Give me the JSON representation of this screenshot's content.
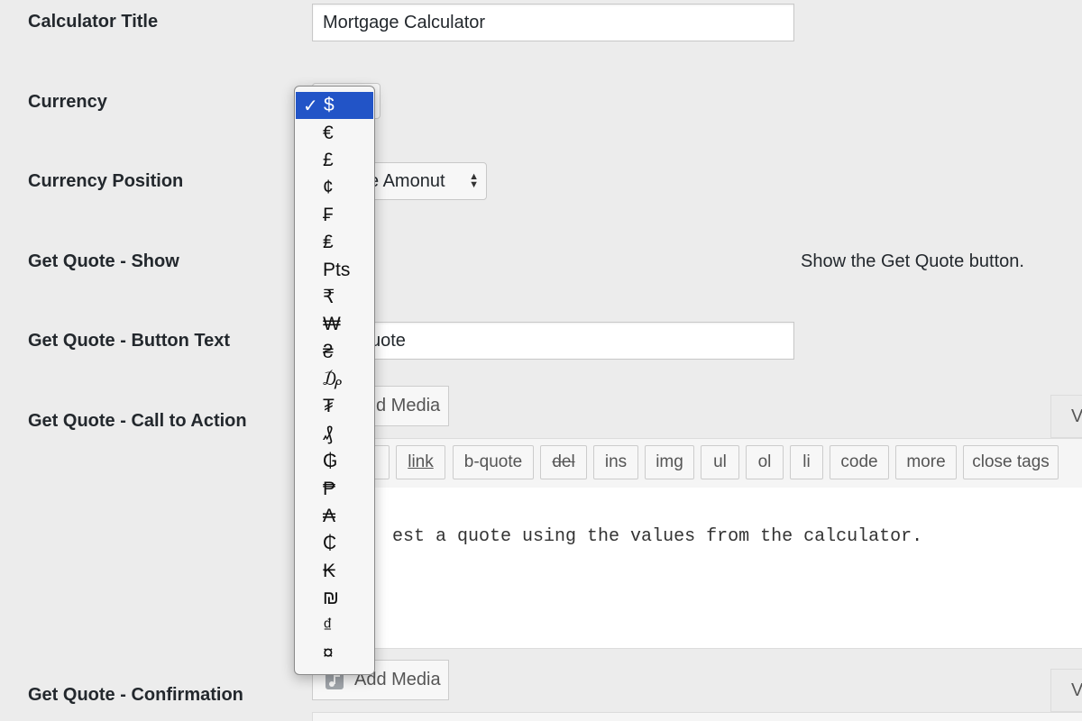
{
  "fields": {
    "calculator_title": {
      "label": "Calculator Title",
      "value": "Mortgage Calculator"
    },
    "currency": {
      "label": "Currency",
      "selected": "$"
    },
    "currency_position": {
      "label": "Currency Position",
      "value": "e Amonut"
    },
    "get_quote_show": {
      "label": "Get Quote - Show",
      "description": "Show the Get Quote button."
    },
    "get_quote_button_text": {
      "label": "Get Quote - Button Text",
      "value": "uote"
    },
    "get_quote_cta": {
      "label": "Get Quote - Call to Action",
      "media_button": "d Media",
      "tab": "V",
      "content": "est a quote using the values from the calculator."
    },
    "get_quote_confirmation": {
      "label": "Get Quote - Confirmation",
      "media_button": "Add Media",
      "tab": "V"
    }
  },
  "toolbar": {
    "buttons": [
      "link",
      "b-quote",
      "del",
      "ins",
      "img",
      "ul",
      "ol",
      "li",
      "code",
      "more",
      "close tags"
    ]
  },
  "currency_dropdown": {
    "checkmark": "✓",
    "options": [
      "$",
      "€",
      "£",
      "¢",
      "₣",
      "₤",
      "Pts",
      "₹",
      "₩",
      "₴",
      "₯",
      "₮",
      "₰",
      "₲",
      "₱",
      "₳",
      "₵",
      "₭",
      "₪",
      "₫",
      "¤"
    ]
  },
  "colors": {
    "background": "#ececec",
    "dropdown_highlight": "#2254c7"
  }
}
